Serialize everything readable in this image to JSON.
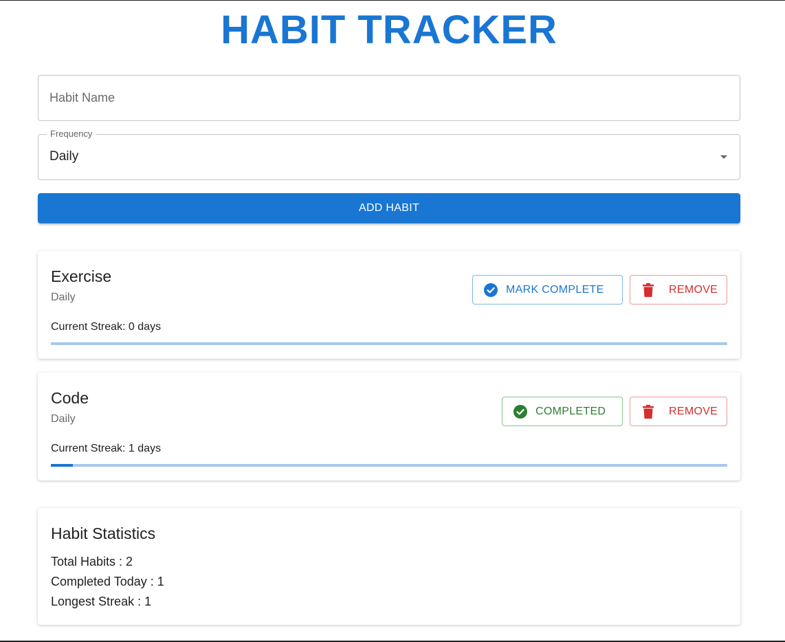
{
  "app": {
    "title": "HABIT TRACKER"
  },
  "form": {
    "habit_name_placeholder": "Habit Name",
    "habit_name_value": "",
    "frequency_label": "Frequency",
    "frequency_value": "Daily",
    "add_button_label": "ADD HABIT"
  },
  "habits": [
    {
      "name": "Exercise",
      "frequency": "Daily",
      "streak_text": "Current Streak: 0 days",
      "action_label": "MARK COMPLETE",
      "action_icon": "check-circle-outline-icon",
      "remove_label": "REMOVE",
      "remove_icon": "trash-icon",
      "progress": 0.0
    },
    {
      "name": "Code",
      "frequency": "Daily",
      "streak_text": "Current Streak: 1 days",
      "action_label": "COMPLETED",
      "action_icon": "check-circle-icon",
      "remove_label": "REMOVE",
      "remove_icon": "trash-icon",
      "progress": 0.033
    }
  ],
  "stats": {
    "title": "Habit Statistics",
    "total_habits": "Total Habits : 2",
    "completed_today": "Completed Today : 1",
    "longest_streak": "Longest Streak : 1"
  },
  "colors": {
    "primary": "#1976d2",
    "success": "#2e7d32",
    "error": "#d32f2f",
    "progress_track": "#a8c8ec"
  }
}
